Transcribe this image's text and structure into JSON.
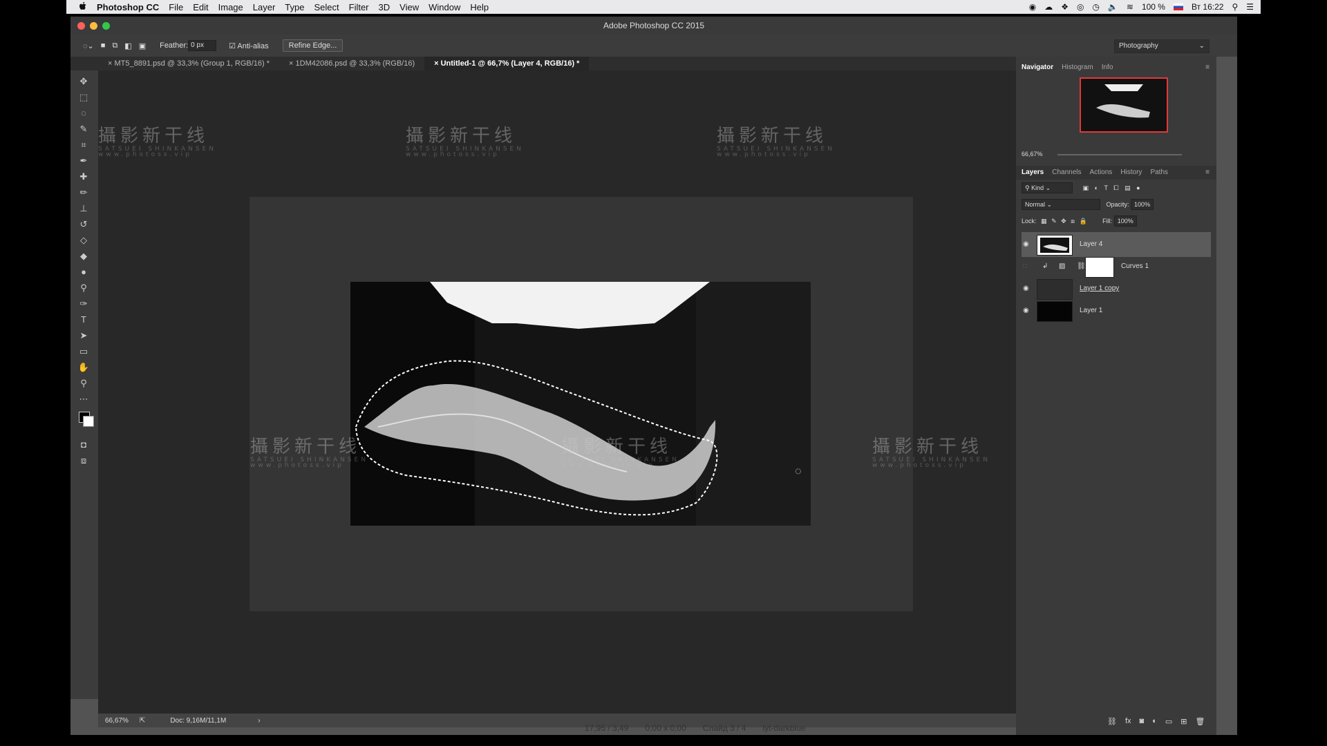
{
  "menubar": {
    "apple": "",
    "app_name": "Photoshop CC",
    "items": [
      "File",
      "Edit",
      "Image",
      "Layer",
      "Type",
      "Select",
      "Filter",
      "3D",
      "View",
      "Window",
      "Help"
    ],
    "battery": "100 %",
    "clock": "Вт 16:22"
  },
  "window": {
    "title": "Adobe Photoshop CC 2015"
  },
  "options": {
    "feather_label": "Feather:",
    "feather_value": "0 px",
    "antialias_label": "Anti-alias",
    "refine_edge": "Refine Edge...",
    "workspace": "Photography"
  },
  "tabs": [
    {
      "label": "MT5_8891.psd @ 33,3% (Group 1, RGB/16) *"
    },
    {
      "label": "1DM42086.psd @ 33,3% (RGB/16)"
    },
    {
      "label": "Untitled-1 @ 66,7% (Layer 4, RGB/16) *"
    }
  ],
  "status": {
    "zoom": "66,67%",
    "doc": "Doc: 9,16M/11,1M"
  },
  "panels": {
    "nav_tabs": [
      "Navigator",
      "Histogram",
      "Info"
    ],
    "nav_zoom": "66,67%",
    "layer_tabs": [
      "Layers",
      "Channels",
      "Actions",
      "History",
      "Paths"
    ],
    "kind": "Kind",
    "blend_mode": "Normal",
    "opacity_label": "Opacity:",
    "opacity_value": "100%",
    "lock_label": "Lock:",
    "fill_label": "Fill:",
    "fill_value": "100%",
    "layers": [
      {
        "name": "Layer 4"
      },
      {
        "name": "Curves 1"
      },
      {
        "name": "Layer 1 copy"
      },
      {
        "name": "Layer 1"
      }
    ],
    "fx": "fx"
  },
  "bottom": {
    "coords": "17,95 / 3,49",
    "size": "0,00 x 0,00",
    "slide": "Слайд 3 / 4",
    "theme": "lyt-darkblue"
  },
  "watermark": {
    "title": "攝影新干线",
    "sub": "SATSUEI SHINKANSEN",
    "url": "www.photoss.vip"
  }
}
